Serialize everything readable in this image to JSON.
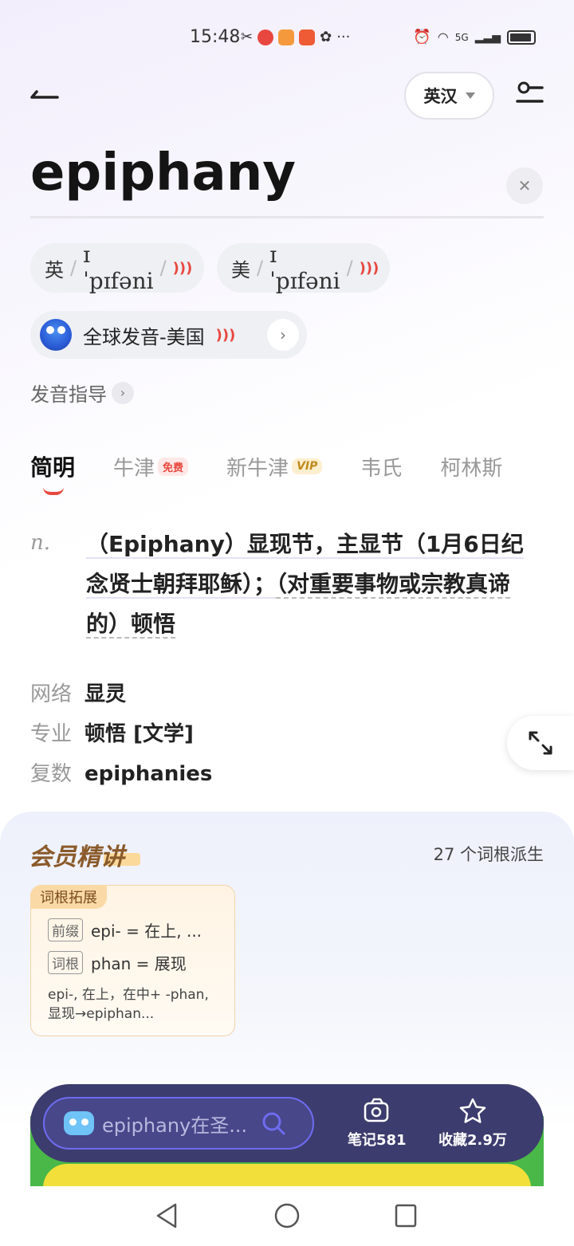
{
  "status": {
    "time": "15:48",
    "more": "···",
    "network": "5G"
  },
  "header": {
    "lang": "英汉"
  },
  "word": "epiphany",
  "pronunciations": {
    "uk": {
      "region": "英",
      "ipa": "ɪˈpɪfəni"
    },
    "us": {
      "region": "美",
      "ipa": "ɪˈpɪfəni"
    }
  },
  "global_pron": "全球发音-美国",
  "guide": "发音指导",
  "tabs": [
    {
      "label": "简明"
    },
    {
      "label": "牛津",
      "badge": "免费"
    },
    {
      "label": "新牛津",
      "badge": "VIP"
    },
    {
      "label": "韦氏"
    },
    {
      "label": "柯林斯"
    }
  ],
  "definition": {
    "pos": "n.",
    "seg1": "（Epiphany）显现节，主显节（1月6日纪念贤士朝拜耶稣）；",
    "seg2": "（对重要事物或宗教真谛的）顿悟"
  },
  "meta": [
    {
      "key": "网络",
      "value": "显灵"
    },
    {
      "key": "专业",
      "value": "顿悟 [文学]"
    },
    {
      "key": "复数",
      "value": "epiphanies"
    }
  ],
  "member": {
    "title": "会员精讲",
    "root_count": "27 个词根派生",
    "card": {
      "tag": "词根拓展",
      "prefix_label": "前缀",
      "prefix_text": "epi- = 在上, ...",
      "root_label": "词根",
      "root_text": "phan = 展现",
      "desc": "epi-, 在上，在中+ -phan, 显现→epiphan..."
    }
  },
  "bottom_bar": {
    "search_placeholder": "epiphany在圣...",
    "notes": "笔记581",
    "favorites": "收藏2.9万"
  },
  "colors": {
    "accent_red": "#e8473f",
    "bar_bg": "#3d3c6e",
    "search_border": "#6e6cf0"
  }
}
